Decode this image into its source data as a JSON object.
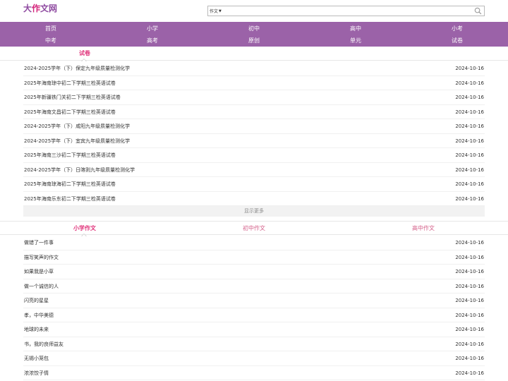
{
  "header": {
    "logo_main_a": "大",
    "logo_main_b": "作",
    "logo_main_c": "文网",
    "search": {
      "select_value": "作文",
      "placeholder": ""
    }
  },
  "nav": {
    "row1": [
      "首页",
      "小学",
      "初中",
      "高中",
      "小考"
    ],
    "row2": [
      "中考",
      "高考",
      "原创",
      "单元",
      "试卷"
    ]
  },
  "exam_section": {
    "tab": "试卷",
    "items": [
      {
        "title": "2024-2025学年（下）保定九年级质量检测化学",
        "date": "2024-10-16"
      },
      {
        "title": "2025年海南琼中初二下学期三检英语试卷",
        "date": "2024-10-16"
      },
      {
        "title": "2025年新疆铁门关初二下学期三检英语试卷",
        "date": "2024-10-16"
      },
      {
        "title": "2025年海南文昌初二下学期三检英语试卷",
        "date": "2024-10-16"
      },
      {
        "title": "2024-2025学年（下）咸阳九年级质量检测化学",
        "date": "2024-10-16"
      },
      {
        "title": "2024-2025学年（下）宜宾九年级质量检测化学",
        "date": "2024-10-16"
      },
      {
        "title": "2025年海南三沙初二下学期三检英语试卷",
        "date": "2024-10-16"
      },
      {
        "title": "2024-2025学年（下）日喀则九年级质量检测化学",
        "date": "2024-10-16"
      },
      {
        "title": "2025年海南琼海初二下学期三检英语试卷",
        "date": "2024-10-16"
      },
      {
        "title": "2025年海南乐东初二下学期三检英语试卷",
        "date": "2024-10-16"
      }
    ],
    "more_label": "显示更多"
  },
  "essay_section": {
    "tabs": [
      "小学作文",
      "初中作文",
      "高中作文"
    ],
    "items": [
      {
        "title": "做错了一件事",
        "date": "2024-10-16"
      },
      {
        "title": "描写笑声的作文",
        "date": "2024-10-16"
      },
      {
        "title": "如果我是小草",
        "date": "2024-10-16"
      },
      {
        "title": "做一个诚信的人",
        "date": "2024-10-16"
      },
      {
        "title": "闪亮的星星",
        "date": "2024-10-16"
      },
      {
        "title": "孝，中华美德",
        "date": "2024-10-16"
      },
      {
        "title": "地球的未来",
        "date": "2024-10-16"
      },
      {
        "title": "书，我的良师益友",
        "date": "2024-10-16"
      },
      {
        "title": "无锡小笼包",
        "date": "2024-10-16"
      },
      {
        "title": "浓浓饺子情",
        "date": "2024-10-16"
      }
    ]
  },
  "colors": {
    "brand": "#9b62a8",
    "accent": "#e0327a"
  }
}
